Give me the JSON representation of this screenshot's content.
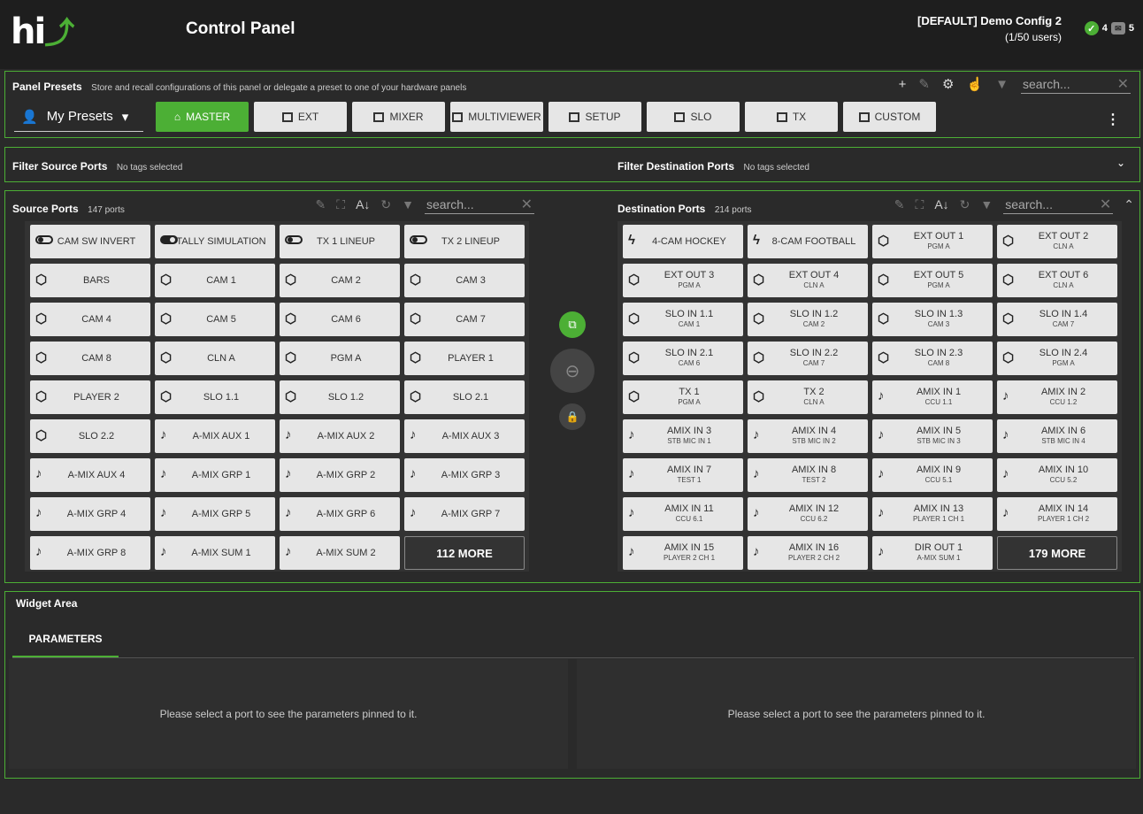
{
  "app": {
    "logo": "hi",
    "title": "Control Panel",
    "config": "[DEFAULT] Demo Config 2",
    "users": "(1/50 users)",
    "ok_count": "4",
    "msg_count": "5"
  },
  "presets": {
    "title": "Panel Presets",
    "description": "Store and recall configurations of this panel or delegate a preset to one of your hardware panels",
    "search_placeholder": "search...",
    "selector": "My Presets",
    "buttons": [
      "MASTER",
      "EXT",
      "MIXER",
      "MULTIVIEWER",
      "SETUP",
      "SLO",
      "TX",
      "CUSTOM"
    ]
  },
  "filter": {
    "source_title": "Filter Source Ports",
    "source_tags": "No tags selected",
    "dest_title": "Filter Destination Ports",
    "dest_tags": "No tags selected"
  },
  "source_ports": {
    "title": "Source Ports",
    "count": "147 ports",
    "search_placeholder": "search...",
    "items": [
      {
        "label": "CAM SW INVERT",
        "icon": "toggle-off-icon"
      },
      {
        "label": "TALLY SIMULATION",
        "icon": "toggle-on-icon"
      },
      {
        "label": "TX 1 LINEUP",
        "icon": "toggle-off-icon"
      },
      {
        "label": "TX 2 LINEUP",
        "icon": "toggle-off-icon"
      },
      {
        "label": "BARS",
        "icon": "cube-icon"
      },
      {
        "label": "CAM 1",
        "icon": "cube-icon"
      },
      {
        "label": "CAM 2",
        "icon": "cube-icon"
      },
      {
        "label": "CAM 3",
        "icon": "cube-icon"
      },
      {
        "label": "CAM 4",
        "icon": "cube-icon"
      },
      {
        "label": "CAM 5",
        "icon": "cube-icon"
      },
      {
        "label": "CAM 6",
        "icon": "cube-icon"
      },
      {
        "label": "CAM 7",
        "icon": "cube-icon"
      },
      {
        "label": "CAM 8",
        "icon": "cube-icon"
      },
      {
        "label": "CLN A",
        "icon": "cube-icon"
      },
      {
        "label": "PGM A",
        "icon": "cube-icon"
      },
      {
        "label": "PLAYER 1",
        "icon": "cube-icon"
      },
      {
        "label": "PLAYER 2",
        "icon": "cube-icon"
      },
      {
        "label": "SLO 1.1",
        "icon": "cube-icon"
      },
      {
        "label": "SLO 1.2",
        "icon": "cube-icon"
      },
      {
        "label": "SLO 2.1",
        "icon": "cube-icon"
      },
      {
        "label": "SLO 2.2",
        "icon": "cube-icon"
      },
      {
        "label": "A-MIX AUX 1",
        "icon": "music-note-icon"
      },
      {
        "label": "A-MIX AUX 2",
        "icon": "music-note-icon"
      },
      {
        "label": "A-MIX AUX 3",
        "icon": "music-note-icon"
      },
      {
        "label": "A-MIX AUX 4",
        "icon": "music-note-icon"
      },
      {
        "label": "A-MIX GRP 1",
        "icon": "music-note-icon"
      },
      {
        "label": "A-MIX GRP 2",
        "icon": "music-note-icon"
      },
      {
        "label": "A-MIX GRP 3",
        "icon": "music-note-icon"
      },
      {
        "label": "A-MIX GRP 4",
        "icon": "music-note-icon"
      },
      {
        "label": "A-MIX GRP 5",
        "icon": "music-note-icon"
      },
      {
        "label": "A-MIX GRP 6",
        "icon": "music-note-icon"
      },
      {
        "label": "A-MIX GRP 7",
        "icon": "music-note-icon"
      },
      {
        "label": "A-MIX GRP 8",
        "icon": "music-note-icon"
      },
      {
        "label": "A-MIX SUM 1",
        "icon": "music-note-icon"
      },
      {
        "label": "A-MIX SUM 2",
        "icon": "music-note-icon"
      }
    ],
    "more": "112 MORE"
  },
  "dest_ports": {
    "title": "Destination Ports",
    "count": "214 ports",
    "search_placeholder": "search...",
    "items": [
      {
        "label": "4-CAM HOCKEY",
        "sub": "",
        "icon": "bolt-icon"
      },
      {
        "label": "8-CAM FOOTBALL",
        "sub": "",
        "icon": "bolt-icon"
      },
      {
        "label": "EXT OUT 1",
        "sub": "PGM A",
        "icon": "cube-icon"
      },
      {
        "label": "EXT OUT 2",
        "sub": "CLN A",
        "icon": "cube-icon"
      },
      {
        "label": "EXT OUT 3",
        "sub": "PGM A",
        "icon": "cube-icon"
      },
      {
        "label": "EXT OUT 4",
        "sub": "CLN A",
        "icon": "cube-icon"
      },
      {
        "label": "EXT OUT 5",
        "sub": "PGM A",
        "icon": "cube-icon"
      },
      {
        "label": "EXT OUT 6",
        "sub": "CLN A",
        "icon": "cube-icon"
      },
      {
        "label": "SLO IN 1.1",
        "sub": "CAM 1",
        "icon": "cube-icon"
      },
      {
        "label": "SLO IN 1.2",
        "sub": "CAM 2",
        "icon": "cube-icon"
      },
      {
        "label": "SLO IN 1.3",
        "sub": "CAM 3",
        "icon": "cube-icon"
      },
      {
        "label": "SLO IN 1.4",
        "sub": "CAM 7",
        "icon": "cube-icon"
      },
      {
        "label": "SLO IN 2.1",
        "sub": "CAM 6",
        "icon": "cube-icon"
      },
      {
        "label": "SLO IN 2.2",
        "sub": "CAM 7",
        "icon": "cube-icon"
      },
      {
        "label": "SLO IN 2.3",
        "sub": "CAM 8",
        "icon": "cube-icon"
      },
      {
        "label": "SLO IN 2.4",
        "sub": "PGM A",
        "icon": "cube-icon"
      },
      {
        "label": "TX 1",
        "sub": "PGM A",
        "icon": "cube-icon"
      },
      {
        "label": "TX 2",
        "sub": "CLN A",
        "icon": "cube-icon"
      },
      {
        "label": "AMIX IN 1",
        "sub": "CCU 1.1",
        "icon": "music-note-icon"
      },
      {
        "label": "AMIX IN 2",
        "sub": "CCU 1.2",
        "icon": "music-note-icon"
      },
      {
        "label": "AMIX IN 3",
        "sub": "STB MIC IN 1",
        "icon": "music-note-icon"
      },
      {
        "label": "AMIX IN 4",
        "sub": "STB MIC IN 2",
        "icon": "music-note-icon"
      },
      {
        "label": "AMIX IN 5",
        "sub": "STB MIC IN 3",
        "icon": "music-note-icon"
      },
      {
        "label": "AMIX IN 6",
        "sub": "STB MIC IN 4",
        "icon": "music-note-icon"
      },
      {
        "label": "AMIX IN 7",
        "sub": "TEST 1",
        "icon": "music-note-icon"
      },
      {
        "label": "AMIX IN 8",
        "sub": "TEST 2",
        "icon": "music-note-icon"
      },
      {
        "label": "AMIX IN 9",
        "sub": "CCU 5.1",
        "icon": "music-note-icon"
      },
      {
        "label": "AMIX IN 10",
        "sub": "CCU 5.2",
        "icon": "music-note-icon"
      },
      {
        "label": "AMIX IN 11",
        "sub": "CCU 6.1",
        "icon": "music-note-icon"
      },
      {
        "label": "AMIX IN 12",
        "sub": "CCU 6.2",
        "icon": "music-note-icon"
      },
      {
        "label": "AMIX IN 13",
        "sub": "PLAYER 1 CH 1",
        "icon": "music-note-icon"
      },
      {
        "label": "AMIX IN 14",
        "sub": "PLAYER 1 CH 2",
        "icon": "music-note-icon"
      },
      {
        "label": "AMIX IN 15",
        "sub": "PLAYER 2 CH 1",
        "icon": "music-note-icon"
      },
      {
        "label": "AMIX IN 16",
        "sub": "PLAYER 2 CH 2",
        "icon": "music-note-icon"
      },
      {
        "label": "DIR OUT 1",
        "sub": "A-MIX SUM 1",
        "icon": "music-note-icon"
      }
    ],
    "more": "179 MORE"
  },
  "widget": {
    "title": "Widget Area",
    "tab": "PARAMETERS",
    "empty_left": "Please select a port to see the parameters pinned to it.",
    "empty_right": "Please select a port to see the parameters pinned to it."
  },
  "colors": {
    "accent": "#4caf35",
    "background": "#2a2a2a",
    "tile": "#e6e6e6"
  }
}
